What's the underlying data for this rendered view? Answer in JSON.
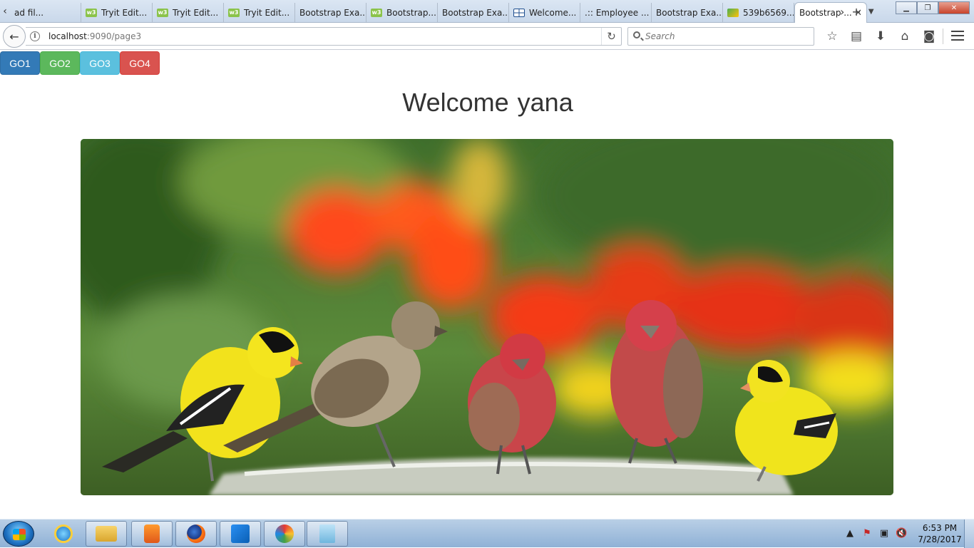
{
  "browser": {
    "tabs": [
      {
        "title": "ad fil...",
        "favicon": "file-icon"
      },
      {
        "title": "Tryit Edit...",
        "favicon": "w3schools-icon"
      },
      {
        "title": "Tryit Edit...",
        "favicon": "w3schools-icon"
      },
      {
        "title": "Tryit Edit...",
        "favicon": "w3schools-icon"
      },
      {
        "title": "Bootstrap Exa...",
        "favicon": "none"
      },
      {
        "title": "Bootstrap...",
        "favicon": "w3schools-icon"
      },
      {
        "title": "Bootstrap Exa...",
        "favicon": "none"
      },
      {
        "title": "Welcome...",
        "favicon": "grid-icon"
      },
      {
        "title": ".:: Employee ...",
        "favicon": "none"
      },
      {
        "title": "Bootstrap Exa...",
        "favicon": "none"
      },
      {
        "title": "539b6569...",
        "favicon": "image-icon"
      },
      {
        "title": "Bootstrap ...",
        "favicon": "none",
        "active": true
      }
    ],
    "url_host": "localhost",
    "url_rest": ":9090/page3",
    "search_placeholder": "Search"
  },
  "page": {
    "buttons": [
      {
        "label": "GO1",
        "style": "primary"
      },
      {
        "label": "GO2",
        "style": "success"
      },
      {
        "label": "GO3",
        "style": "info"
      },
      {
        "label": "GO4",
        "style": "danger"
      }
    ],
    "welcome_prefix": "Welcome",
    "welcome_name": "yana",
    "image_subject": "birds-photo"
  },
  "taskbar": {
    "clock_time": "6:53 PM",
    "clock_date": "7/28/2017",
    "pinned_apps": [
      "internet-explorer-icon",
      "file-explorer-icon",
      "media-player-icon",
      "firefox-icon",
      "visual-studio-icon",
      "paint-icon",
      "notepad-icon"
    ]
  },
  "colors": {
    "primary": "#337ab7",
    "success": "#5cb85c",
    "info": "#5bc0de",
    "danger": "#d9534f"
  }
}
